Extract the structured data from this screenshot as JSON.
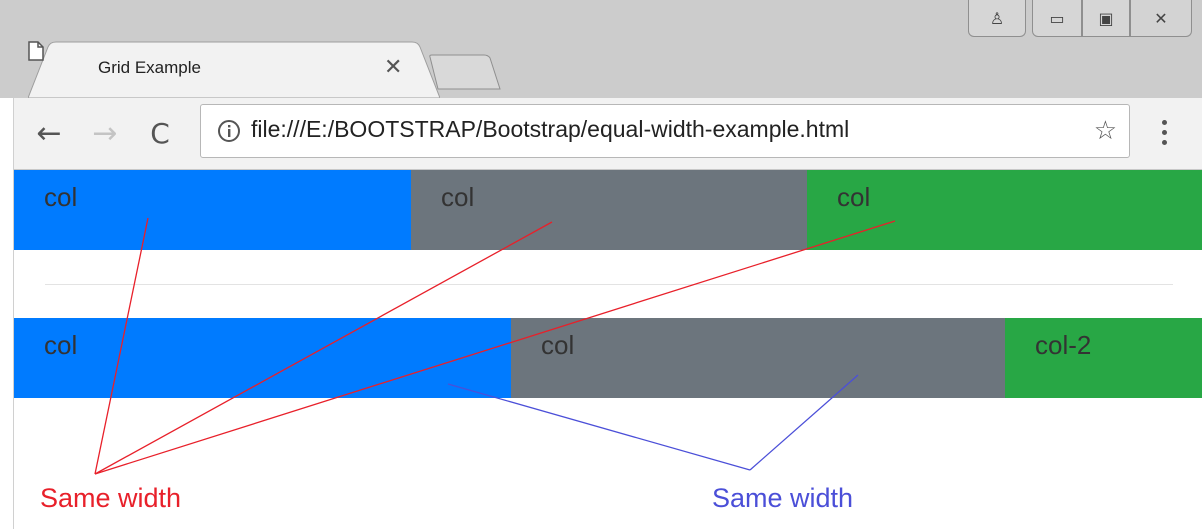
{
  "window": {
    "tab_title": "Grid Example",
    "tab_close": "✕",
    "controls": {
      "profile": "♙",
      "minimize": "▭",
      "maximize": "▣",
      "close": "✕"
    }
  },
  "toolbar": {
    "back": "←",
    "forward": "→",
    "reload": "C",
    "url": "file:///E:/BOOTSTRAP/Bootstrap/equal-width-example.html",
    "star": "☆"
  },
  "page": {
    "row1": [
      {
        "label": "col",
        "color": "#007bff"
      },
      {
        "label": "col",
        "color": "#6c757d"
      },
      {
        "label": "col",
        "color": "#28a745"
      }
    ],
    "row2": [
      {
        "label": "col",
        "color": "#007bff"
      },
      {
        "label": "col",
        "color": "#6c757d"
      },
      {
        "label": "col-2",
        "color": "#28a745"
      }
    ]
  },
  "annotations": {
    "red_label": "Same width",
    "blue_label": "Same width",
    "red_color": "#e8202a",
    "blue_color": "#4b4fd8"
  }
}
